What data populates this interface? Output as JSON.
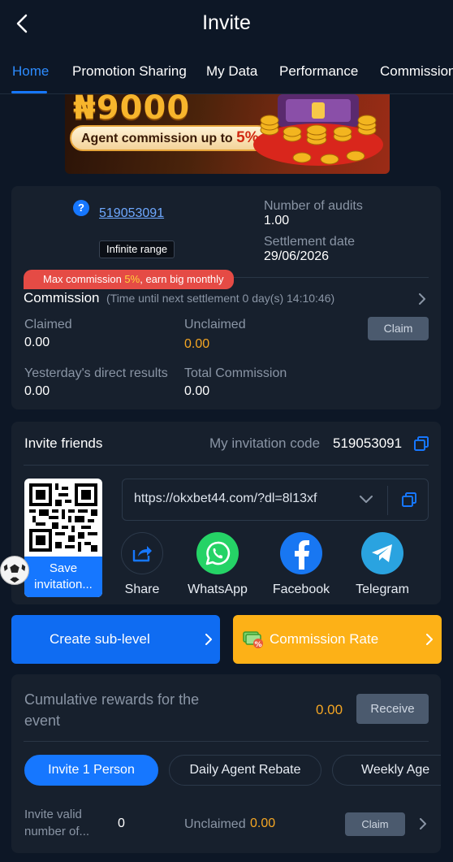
{
  "header": {
    "title": "Invite"
  },
  "tabs": [
    "Home",
    "Promotion Sharing",
    "My Data",
    "Performance",
    "Commission"
  ],
  "banner": {
    "amount": "₦9000",
    "pill_text": "Agent commission up to ",
    "pill_pct": "5%"
  },
  "agent": {
    "id": "519053091",
    "range_tag": "Infinite range",
    "audits_label": "Number of audits",
    "audits_value": "1.00",
    "settlement_label": "Settlement date",
    "settlement_value": "29/06/2026"
  },
  "commission": {
    "ribbon_pre": "Max commission ",
    "ribbon_pct": "5%",
    "ribbon_post": ", earn big monthly",
    "title": "Commission",
    "subtitle": "(Time until next settlement  0 day(s) 14:10:46)",
    "claimed_label": "Claimed",
    "claimed_value": "0.00",
    "unclaimed_label": "Unclaimed",
    "unclaimed_value": "0.00",
    "claim_button": "Claim",
    "yesterday_label": "Yesterday's direct results",
    "yesterday_value": "0.00",
    "total_label": "Total Commission",
    "total_value": "0.00"
  },
  "invite": {
    "title": "Invite friends",
    "code_label": "My invitation code",
    "code_value": "519053091",
    "qr_save_label": "Save invitation...",
    "url": "https://okxbet44.com/?dl=8l13xf",
    "share": [
      {
        "label": "Share",
        "icon": "share-icon"
      },
      {
        "label": "WhatsApp",
        "icon": "whatsapp-icon"
      },
      {
        "label": "Facebook",
        "icon": "facebook-icon"
      },
      {
        "label": "Telegram",
        "icon": "telegram-icon"
      }
    ]
  },
  "actions": {
    "create_sublevel": "Create sub-level",
    "commission_rate": "Commission Rate"
  },
  "rewards": {
    "title": "Cumulative rewards for the event",
    "value": "0.00",
    "receive_button": "Receive",
    "pills": [
      "Invite 1 Person",
      "Daily Agent Rebate",
      "Weekly Age"
    ],
    "valid_label": "Invite valid number of...",
    "valid_value": "0",
    "unclaimed_label": "Unclaimed",
    "unclaimed_value": "0.00",
    "claim_button": "Claim"
  },
  "colors": {
    "accent": "#1677ff",
    "gold": "#f5a623",
    "orange_button": "#fdb117",
    "background": "#0d1726",
    "card": "#17202d"
  }
}
